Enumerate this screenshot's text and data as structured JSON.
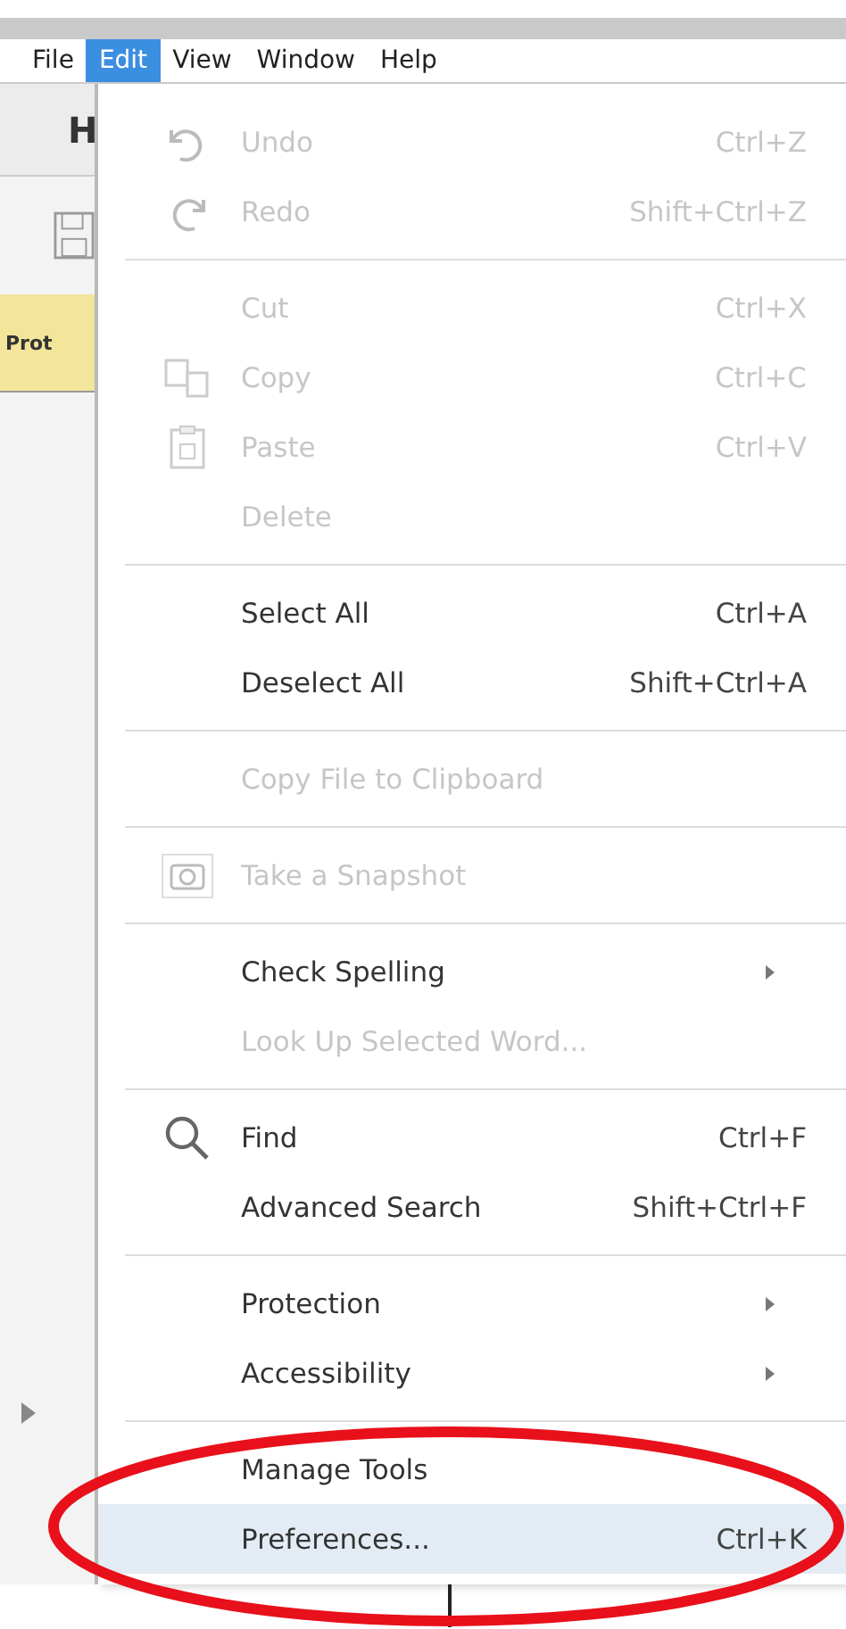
{
  "menu_bar": [
    {
      "label": "File",
      "selected": false
    },
    {
      "label": "Edit",
      "selected": true
    },
    {
      "label": "View",
      "selected": false
    },
    {
      "label": "Window",
      "selected": false
    },
    {
      "label": "Help",
      "selected": false
    }
  ],
  "side_panel": {
    "heading": "H",
    "banner": "Prot"
  },
  "edit_menu": [
    {
      "kind": "item",
      "label": "Undo",
      "shortcut": "Ctrl+Z",
      "disabled": true,
      "selected": false
    },
    {
      "kind": "item",
      "label": "Redo",
      "shortcut": "Shift+Ctrl+Z",
      "disabled": true,
      "selected": false
    },
    {
      "kind": "separator"
    },
    {
      "kind": "item",
      "label": "Cut",
      "shortcut": "Ctrl+X",
      "disabled": true,
      "selected": false
    },
    {
      "kind": "item",
      "label": "Copy",
      "shortcut": "Ctrl+C",
      "disabled": true,
      "selected": false
    },
    {
      "kind": "item",
      "label": "Paste",
      "shortcut": "Ctrl+V",
      "disabled": true,
      "selected": false
    },
    {
      "kind": "item",
      "label": "Delete",
      "disabled": true,
      "selected": false
    },
    {
      "kind": "separator"
    },
    {
      "kind": "item",
      "label": "Select All",
      "shortcut": "Ctrl+A",
      "disabled": false,
      "selected": false
    },
    {
      "kind": "item",
      "label": "Deselect All",
      "shortcut": "Shift+Ctrl+A",
      "disabled": false,
      "selected": false
    },
    {
      "kind": "separator"
    },
    {
      "kind": "item",
      "label": "Copy File to Clipboard",
      "disabled": true,
      "selected": false
    },
    {
      "kind": "separator"
    },
    {
      "kind": "item",
      "label": "Take a Snapshot",
      "disabled": true,
      "selected": false
    },
    {
      "kind": "separator"
    },
    {
      "kind": "submenu",
      "label": "Check Spelling",
      "disabled": false,
      "selected": false
    },
    {
      "kind": "item",
      "label": "Look Up Selected Word...",
      "disabled": true,
      "selected": false
    },
    {
      "kind": "separator"
    },
    {
      "kind": "item",
      "label": "Find",
      "shortcut": "Ctrl+F",
      "disabled": false,
      "selected": false
    },
    {
      "kind": "item",
      "label": "Advanced Search",
      "shortcut": "Shift+Ctrl+F",
      "disabled": false,
      "selected": false
    },
    {
      "kind": "separator"
    },
    {
      "kind": "submenu",
      "label": "Protection",
      "disabled": false,
      "selected": false
    },
    {
      "kind": "submenu",
      "label": "Accessibility",
      "disabled": false,
      "selected": false
    },
    {
      "kind": "separator"
    },
    {
      "kind": "item",
      "label": "Manage Tools",
      "disabled": false,
      "selected": false
    },
    {
      "kind": "item",
      "label": "Preferences...",
      "shortcut": "Ctrl+K",
      "disabled": false,
      "selected": true
    }
  ]
}
